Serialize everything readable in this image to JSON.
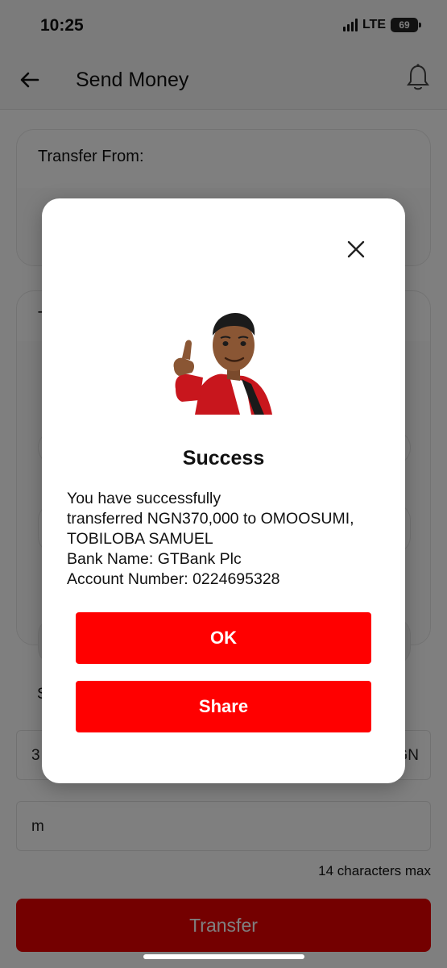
{
  "status_bar": {
    "time": "10:25",
    "network": "LTE",
    "battery": "69"
  },
  "header": {
    "title": "Send Money",
    "back_icon": "arrow-left-icon",
    "notification_icon": "bell-icon"
  },
  "transfer_from": {
    "title": "Transfer From:"
  },
  "transfer_to": {
    "title": "T"
  },
  "amount_section": {
    "label": "S",
    "value": "3",
    "currency": "GN"
  },
  "narration": {
    "value": "m",
    "hint": "14 characters max"
  },
  "transfer_button": {
    "label": "Transfer"
  },
  "modal": {
    "close_icon": "close-icon",
    "title": "Success",
    "message_lines": [
      "You have successfully",
      "transferred NGN370,000 to OMOOSUMI,",
      "TOBILOBA SAMUEL",
      "Bank Name: GTBank Plc",
      "Account Number: 0224695328"
    ],
    "ok_label": "OK",
    "share_label": "Share"
  },
  "colors": {
    "primary": "#ff0000",
    "overlay": "rgba(0,0,0,0.5)"
  }
}
